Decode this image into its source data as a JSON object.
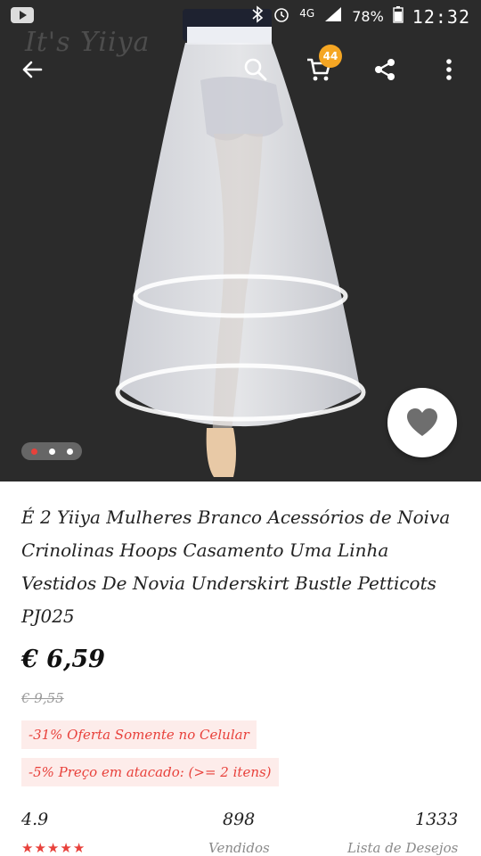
{
  "status_bar": {
    "network": "4G",
    "battery": "78%",
    "time": "12:32"
  },
  "hero": {
    "watermark": "It's Yiiya",
    "image_count": 3,
    "active_image": 1
  },
  "toolbar": {
    "cart_count": "44",
    "icons": [
      "back-arrow-icon",
      "search-icon",
      "cart-icon",
      "share-icon",
      "more-vert-icon"
    ]
  },
  "product": {
    "title": "É 2 Yiiya Mulheres Branco Acessórios de Noiva Crinolinas Hoops Casamento Uma Linha Vestidos De Novia Underskirt Bustle Petticots PJ025",
    "price": "€ 6,59",
    "original_price": "€ 9,55",
    "promo_mobile": "-31% Oferta Somente no Celular",
    "promo_wholesale": "-5% Preço em atacado: (>= 2 itens)"
  },
  "stats": {
    "rating": "4.9",
    "rating_stars": 5,
    "sold_count": "898",
    "sold_label": "Vendidos",
    "wishlist_count": "1333",
    "wishlist_label": "Lista de Desejos"
  },
  "colors": {
    "accent": "#e8413b",
    "badge": "#f5a623",
    "promo_bg": "#fdecea"
  }
}
